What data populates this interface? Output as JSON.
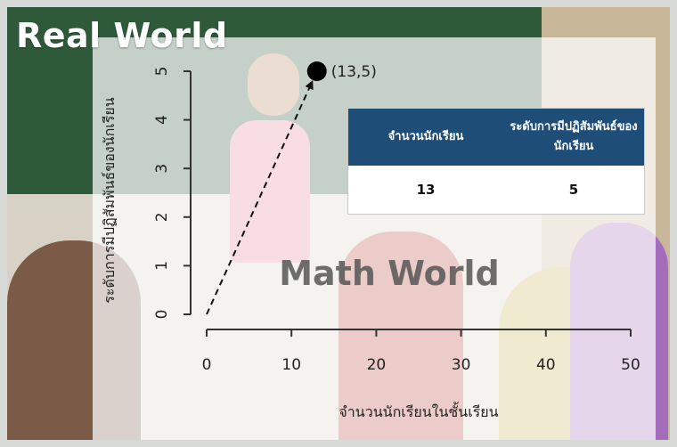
{
  "real_world_title": "Real World",
  "watermark": "Math World",
  "table": {
    "headers": [
      "จำนวนนักเรียน",
      "ระดับการมีปฏิสัมพันธ์ของนักเรียน"
    ],
    "rows": [
      [
        "13",
        "5"
      ]
    ]
  },
  "chart_data": {
    "type": "line",
    "xlabel": "จำนวนนักเรียนในชั้นเรียน",
    "ylabel": "ระดับการมีปฏิสัมพันธ์ของนักเรียน",
    "xlim": [
      0,
      50
    ],
    "ylim": [
      0,
      5
    ],
    "xticks": [
      "0",
      "10",
      "20",
      "30",
      "40",
      "50"
    ],
    "yticks": [
      "0",
      "1",
      "2",
      "3",
      "4",
      "5"
    ],
    "series": [
      {
        "style": "dashed-arrow",
        "x": [
          0,
          13
        ],
        "y": [
          0,
          5
        ]
      }
    ],
    "points": [
      {
        "x": 13,
        "y": 5,
        "label": "(13,5)"
      }
    ],
    "grid": false
  }
}
